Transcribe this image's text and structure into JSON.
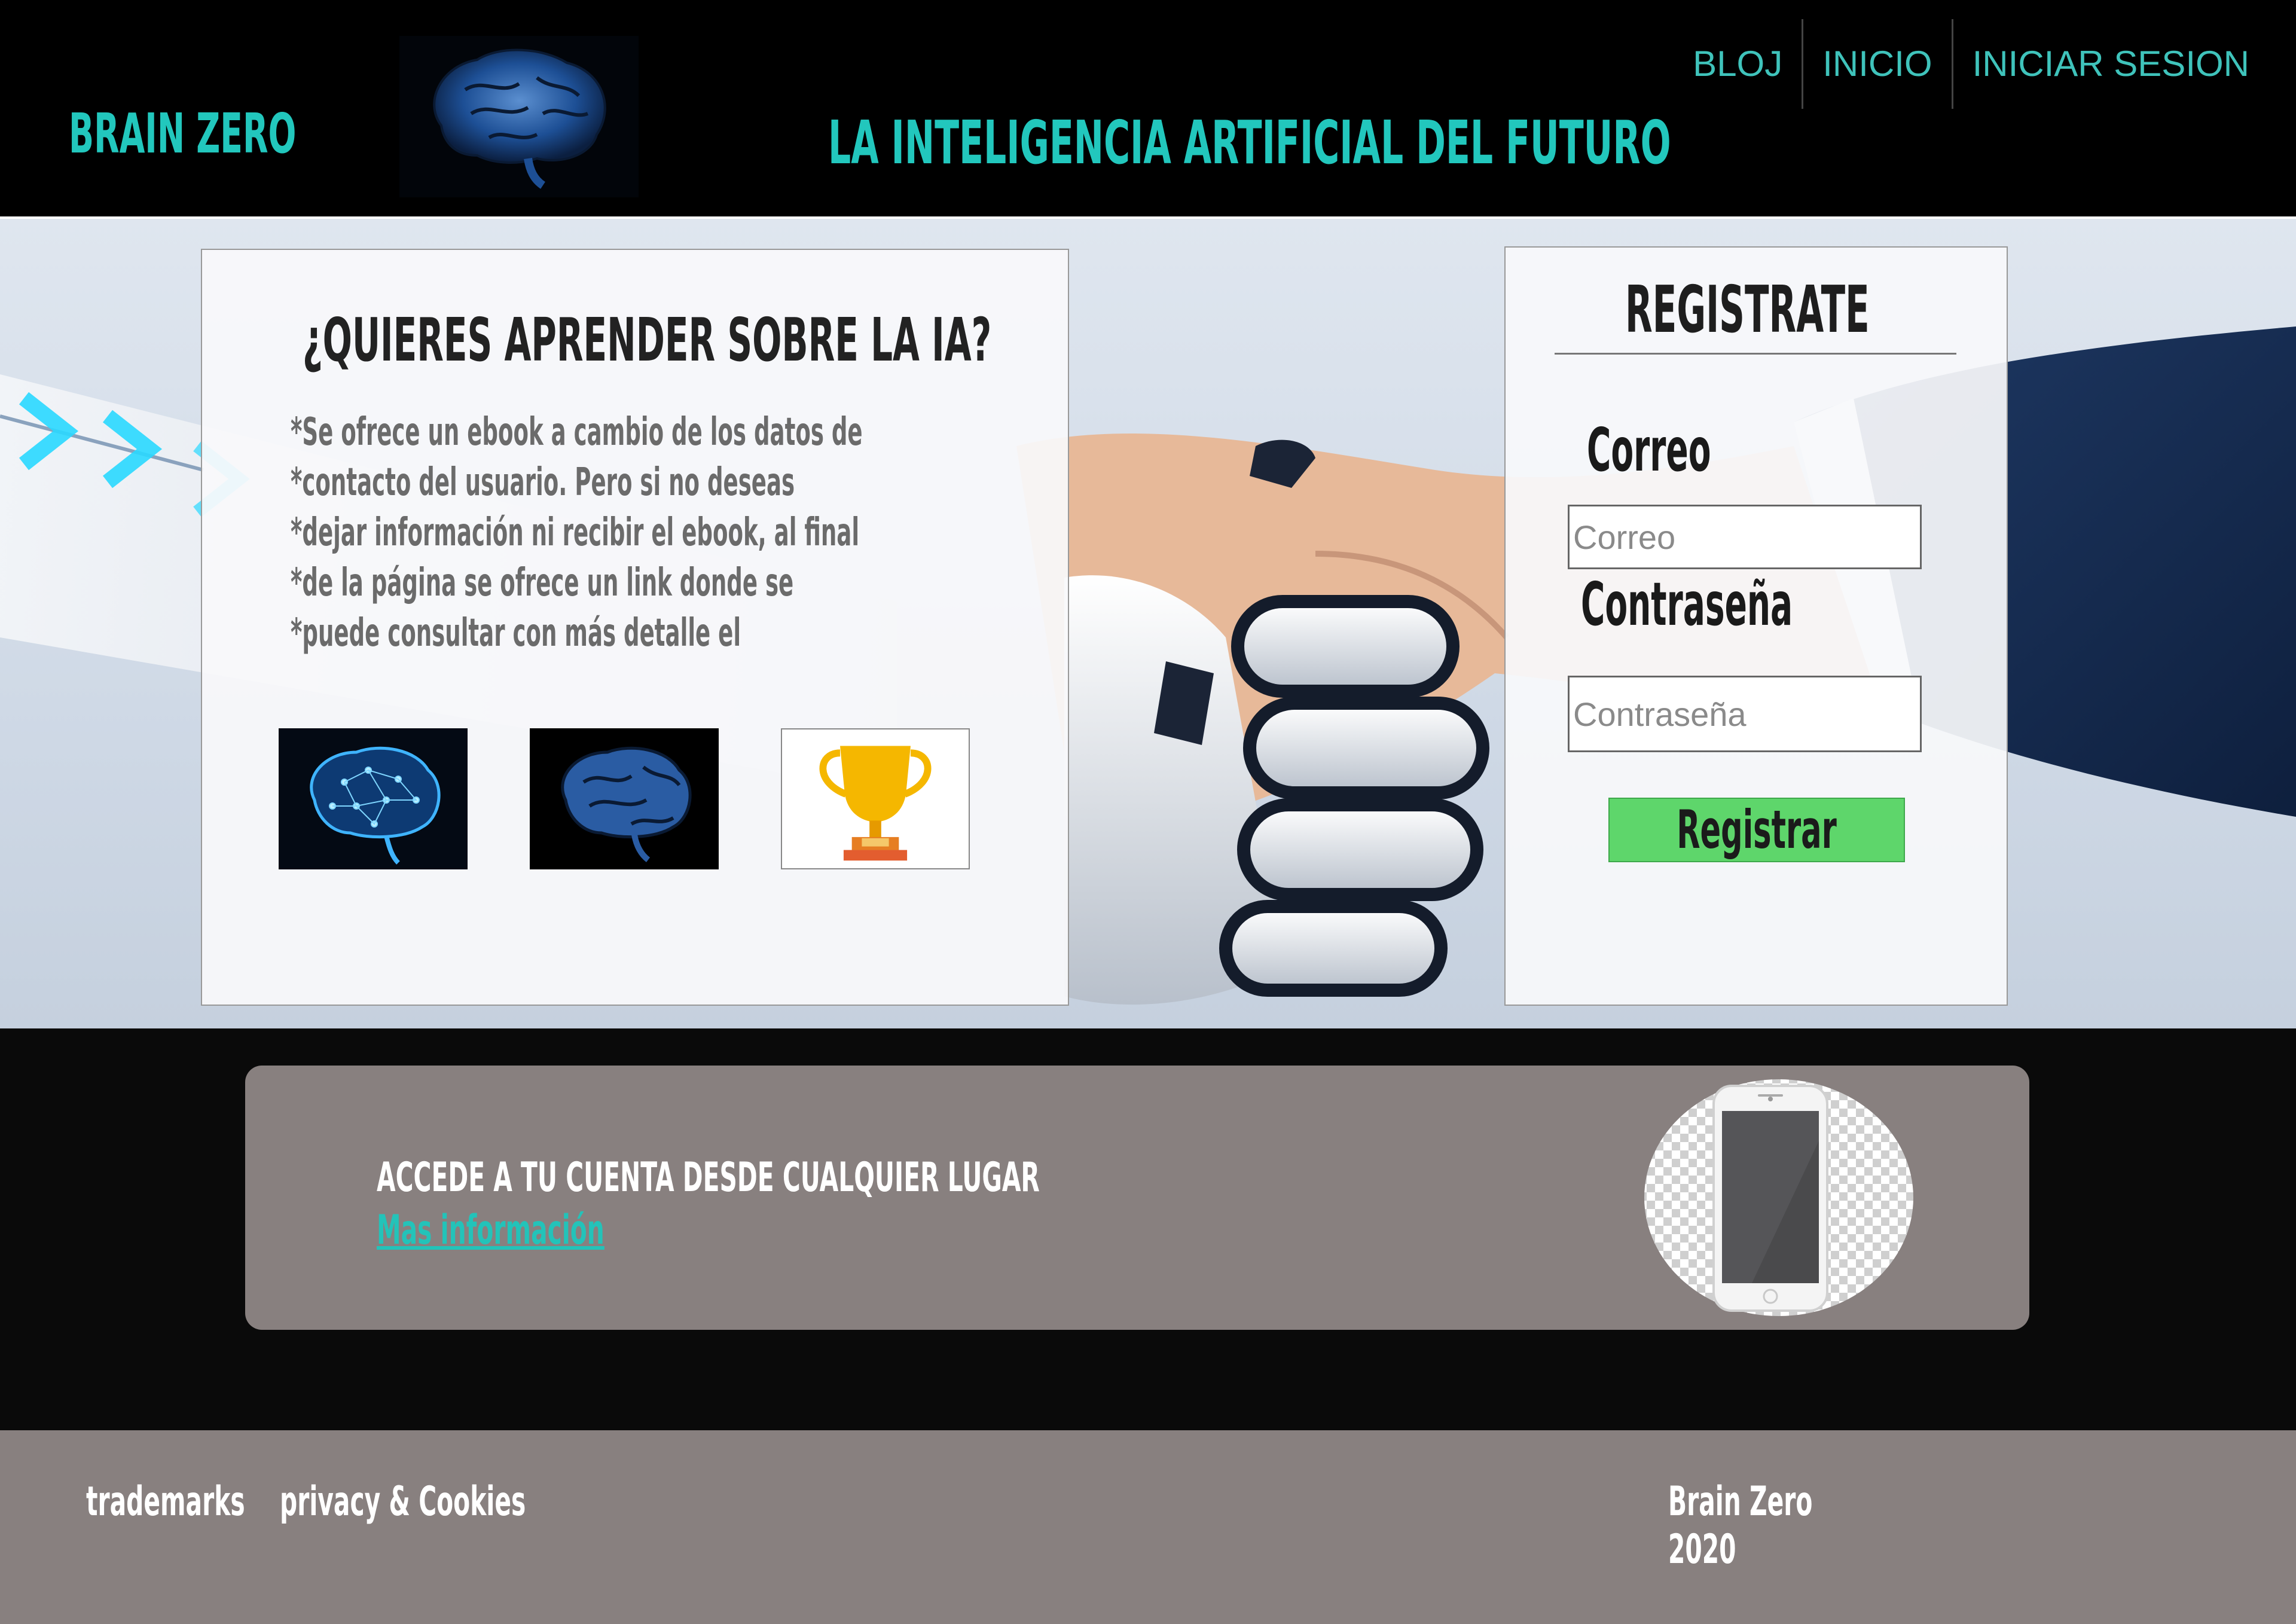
{
  "header": {
    "brand": "BRAIN ZERO",
    "tagline": "LA INTELIGENCIA ARTIFICIAL DEL FUTURO",
    "logo_icon": "brain-icon",
    "nav": [
      {
        "label": "BLOJ"
      },
      {
        "label": "INICIO"
      },
      {
        "label": "INICIAR SESION"
      }
    ]
  },
  "info": {
    "title": "¿QUIERES APRENDER SOBRE LA IA?",
    "lines": [
      "*Se ofrece un ebook a cambio de los datos de",
      "*contacto del usuario. Pero si no deseas",
      "*dejar información ni recibir el ebook, al final",
      "*de la página se ofrece un link donde se",
      "*puede consultar con más detalle el"
    ],
    "thumbnails": [
      "neural-brain-icon",
      "brain-icon",
      "trophy-icon"
    ]
  },
  "register": {
    "title": "REGISTRATE",
    "email_label": "Correo",
    "email_placeholder": "Correo",
    "password_label": "Contraseña",
    "password_placeholder": "Contraseña",
    "button_label": "Registrar"
  },
  "promo": {
    "text": "ACCEDE A TU CUENTA DESDE CUALQUIER LUGAR",
    "link": "Mas información",
    "image_icon": "smartphone-icon"
  },
  "footer": {
    "links": [
      "trademarks",
      "privacy & Cookies"
    ],
    "brand": "Brain Zero",
    "year": "2020"
  },
  "colors": {
    "accent": "#22c7bd",
    "header_bg": "#000000",
    "promo_bg": "#88807f",
    "button": "#5ed66b"
  }
}
